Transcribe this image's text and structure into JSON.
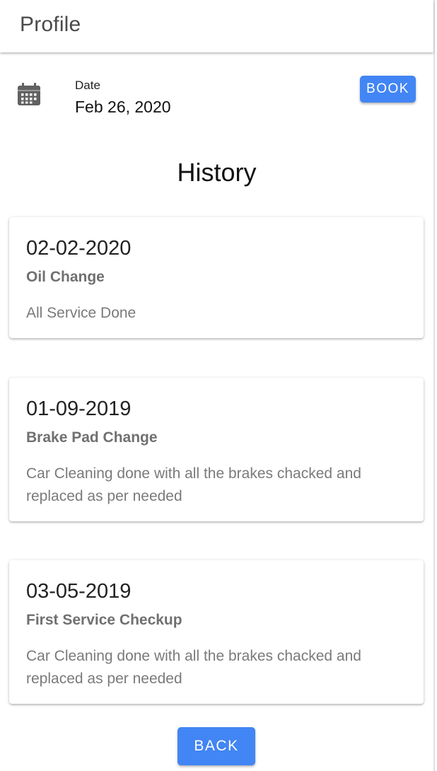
{
  "app_bar": {
    "title": "Profile"
  },
  "date_section": {
    "icon": "calendar-icon",
    "label": "Date",
    "value": "Feb 26, 2020",
    "book_label": "BOOK"
  },
  "history": {
    "title": "History",
    "cards": [
      {
        "date": "02-02-2020",
        "title": "Oil Change",
        "body": "All Service Done"
      },
      {
        "date": "01-09-2019",
        "title": "Brake Pad Change",
        "body": "Car Cleaning done with all the brakes chacked and replaced as per needed"
      },
      {
        "date": "03-05-2019",
        "title": "First Service Checkup",
        "body": "Car Cleaning done with all the brakes chacked and replaced as per needed"
      }
    ]
  },
  "back_label": "BACK",
  "colors": {
    "accent": "#4285f4",
    "title_text": "#4a4a4a",
    "muted_text": "#7a7a7a"
  }
}
